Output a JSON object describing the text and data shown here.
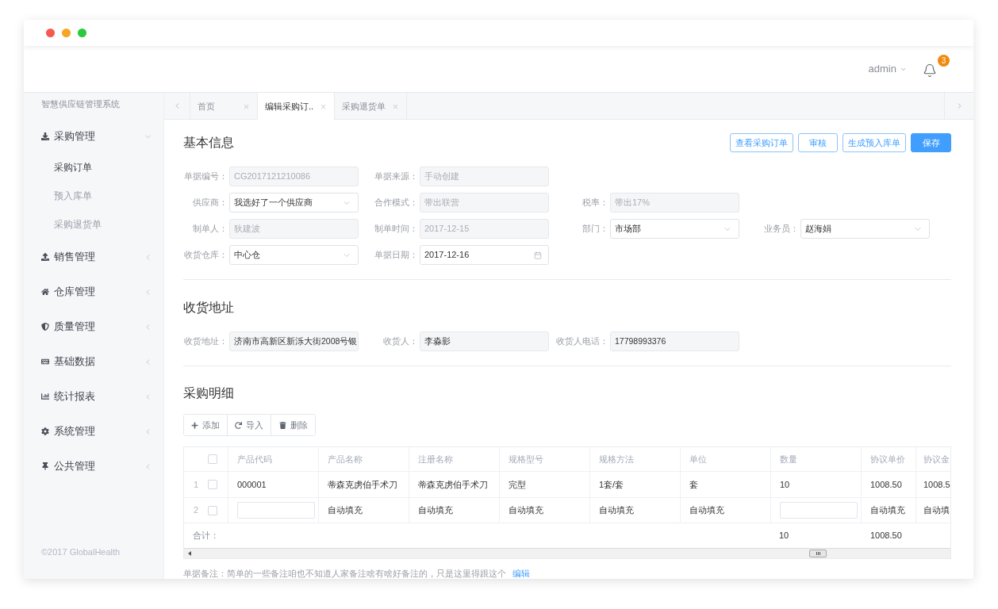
{
  "header": {
    "user": "admin",
    "notifications": "3"
  },
  "sidebar": {
    "title": "智慧供应链管理系统",
    "items": [
      {
        "label": "采购管理",
        "expanded": true,
        "children": [
          {
            "label": "采购订单",
            "selected": true
          },
          {
            "label": "预入库单",
            "selected": false
          },
          {
            "label": "采购退货单",
            "selected": false
          }
        ]
      },
      {
        "label": "销售管理",
        "expanded": false
      },
      {
        "label": "仓库管理",
        "expanded": false
      },
      {
        "label": "质量管理",
        "expanded": false
      },
      {
        "label": "基础数据",
        "expanded": false
      },
      {
        "label": "统计报表",
        "expanded": false
      },
      {
        "label": "系统管理",
        "expanded": false
      },
      {
        "label": "公共管理",
        "expanded": false
      }
    ],
    "footer": "©2017 GlobalHealth"
  },
  "tabs": [
    {
      "label": "首页",
      "selected": false
    },
    {
      "label": "编辑采购订..",
      "selected": true
    },
    {
      "label": "采购退货单",
      "selected": false
    }
  ],
  "basic_info": {
    "title": "基本信息",
    "actions": [
      {
        "label": "查看采购订单",
        "primary": false
      },
      {
        "label": "审核",
        "primary": false
      },
      {
        "label": "生成预入库单",
        "primary": false
      },
      {
        "label": "保存",
        "primary": true
      }
    ],
    "rows": [
      {
        "fields": [
          {
            "label": "单据编号：",
            "value": "CG2017121210086",
            "kind": "text",
            "disabled": true
          },
          {
            "label": "单据来源：",
            "value": "手动创建",
            "kind": "text",
            "disabled": true
          }
        ]
      },
      {
        "fields": [
          {
            "label": "供应商：",
            "value": "我选好了一个供应商",
            "kind": "select",
            "disabled": false
          },
          {
            "label": "合作模式：",
            "value": "带出联营",
            "kind": "text",
            "disabled": true
          },
          {
            "label": "税率：",
            "value": "带出17%",
            "kind": "text",
            "disabled": true
          }
        ]
      },
      {
        "fields": [
          {
            "label": "制单人：",
            "value": "狄建波",
            "kind": "text",
            "disabled": true
          },
          {
            "label": "制单时间：",
            "value": "2017-12-15",
            "kind": "text",
            "disabled": true
          },
          {
            "label": "部门：",
            "value": "市场部",
            "kind": "select",
            "disabled": false
          },
          {
            "label": "业务员：",
            "value": "赵海娟",
            "kind": "select",
            "disabled": false
          }
        ]
      },
      {
        "fields": [
          {
            "label": "收货仓库：",
            "value": "中心仓",
            "kind": "select",
            "disabled": false
          },
          {
            "label": "单据日期：",
            "value": "2017-12-16",
            "kind": "date",
            "disabled": false
          }
        ]
      }
    ]
  },
  "address": {
    "title": "收货地址",
    "fields": [
      {
        "label": "收货地址：",
        "value": "济南市高新区新泺大街2008号银",
        "kind": "text",
        "disabled": false
      },
      {
        "label": "收货人：",
        "value": "李淼影",
        "kind": "text",
        "disabled": false
      },
      {
        "label": "收货人电话：",
        "value": "17798993376",
        "kind": "text",
        "disabled": false
      }
    ]
  },
  "detail": {
    "title": "采购明细",
    "toolbar": [
      {
        "label": "添加"
      },
      {
        "label": "导入"
      },
      {
        "label": "删除"
      }
    ],
    "table": {
      "select_all": {
        "checked": false
      },
      "columns": [
        "产品代码",
        "产品名称",
        "注册名称",
        "规格型号",
        "规格方法",
        "单位",
        "数量",
        "协议单价",
        "协议金"
      ],
      "rows": [
        {
          "index": "1",
          "checked": false,
          "cells": [
            {
              "kind": "text",
              "value": "000001"
            },
            {
              "kind": "text",
              "value": "蒂森克虏伯手术刀"
            },
            {
              "kind": "text",
              "value": "蒂森克虏伯手术刀"
            },
            {
              "kind": "text",
              "value": "完型"
            },
            {
              "kind": "text",
              "value": "1套/套"
            },
            {
              "kind": "text",
              "value": "套"
            },
            {
              "kind": "text",
              "value": "10"
            },
            {
              "kind": "text",
              "value": "1008.50"
            },
            {
              "kind": "text",
              "value": "1008.5"
            }
          ]
        },
        {
          "index": "2",
          "checked": false,
          "cells": [
            {
              "kind": "input"
            },
            {
              "kind": "text",
              "value": "自动填充"
            },
            {
              "kind": "text",
              "value": "自动填充"
            },
            {
              "kind": "text",
              "value": "自动填充"
            },
            {
              "kind": "text",
              "value": "自动填充"
            },
            {
              "kind": "text",
              "value": "自动填充"
            },
            {
              "kind": "input"
            },
            {
              "kind": "text",
              "value": "自动填充"
            },
            {
              "kind": "text",
              "value": "自动填"
            }
          ]
        }
      ],
      "total": {
        "label": "合计：",
        "quantity": "10",
        "unit_price": "1008.50"
      }
    },
    "note": {
      "text": "单据备注：简单的一些备注咱也不知道人家备注啥有啥好备注的，只是这里得跟这个",
      "link": "编辑"
    }
  }
}
